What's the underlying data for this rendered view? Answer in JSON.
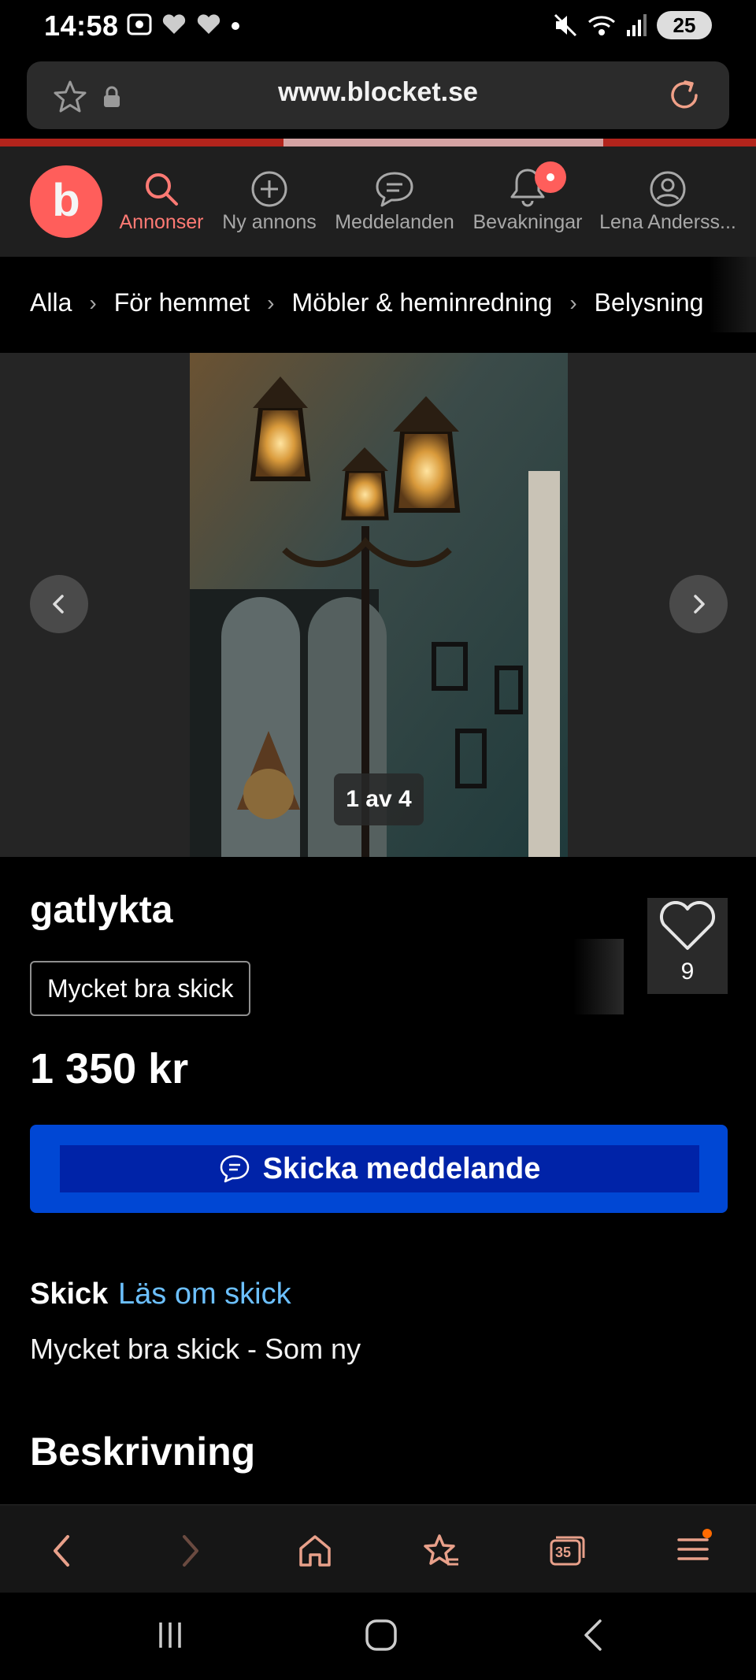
{
  "status_bar": {
    "time": "14:58",
    "battery": "25"
  },
  "browser": {
    "url": "www.blocket.se",
    "nav_buttons": [
      "back",
      "forward",
      "home",
      "bookmarks",
      "tabs",
      "menu"
    ],
    "tab_count": "35",
    "accent_color": "#e8a08a"
  },
  "header": {
    "logo_letter": "b",
    "brand_color": "#ff5e5b",
    "nav": [
      {
        "label": "Annonser",
        "icon": "search-icon",
        "active": true
      },
      {
        "label": "Ny annons",
        "icon": "plus-circle-icon"
      },
      {
        "label": "Meddelanden",
        "icon": "chat-icon"
      },
      {
        "label": "Bevakningar",
        "icon": "bell-icon"
      },
      {
        "label": "Lena Anderss...",
        "icon": "user-icon"
      }
    ]
  },
  "breadcrumb": [
    "Alla",
    "För hemmet",
    "Möbler & heminredning",
    "Belysning"
  ],
  "gallery": {
    "counter": "1 av 4"
  },
  "listing": {
    "title": "gatlykta",
    "condition_tag": "Mycket bra skick",
    "favorites_count": "9",
    "price": "1 350 kr",
    "cta_label": "Skicka meddelande",
    "cta_color": "#0047d4",
    "condition_label": "Skick",
    "condition_link": "Läs om skick",
    "condition_value": "Mycket bra skick - Som ny",
    "description_heading": "Beskrivning"
  }
}
